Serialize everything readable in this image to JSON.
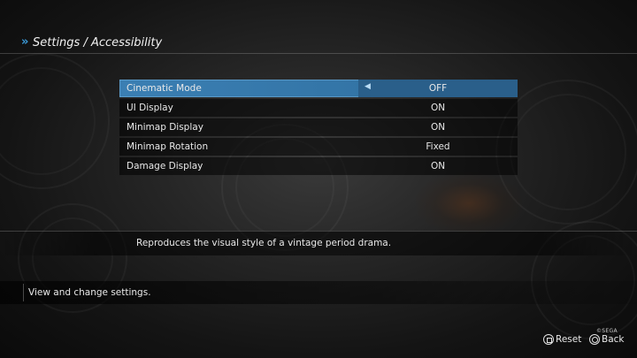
{
  "header": {
    "chevron": "»",
    "title": "Settings / Accessibility"
  },
  "settings": [
    {
      "label": "Cinematic Mode",
      "value": "OFF",
      "selected": true
    },
    {
      "label": "UI Display",
      "value": "ON",
      "selected": false
    },
    {
      "label": "Minimap Display",
      "value": "ON",
      "selected": false
    },
    {
      "label": "Minimap Rotation",
      "value": "Fixed",
      "selected": false
    },
    {
      "label": "Damage Display",
      "value": "ON",
      "selected": false
    }
  ],
  "description": "Reproduces the visual style of a vintage period drama.",
  "help_text": "View and change settings.",
  "footer": {
    "reset_label": "Reset",
    "back_label": "Back",
    "copyright": "©SEGA"
  },
  "colors": {
    "accent": "#3a9ad8",
    "selected_row": "#3b7fb3"
  }
}
